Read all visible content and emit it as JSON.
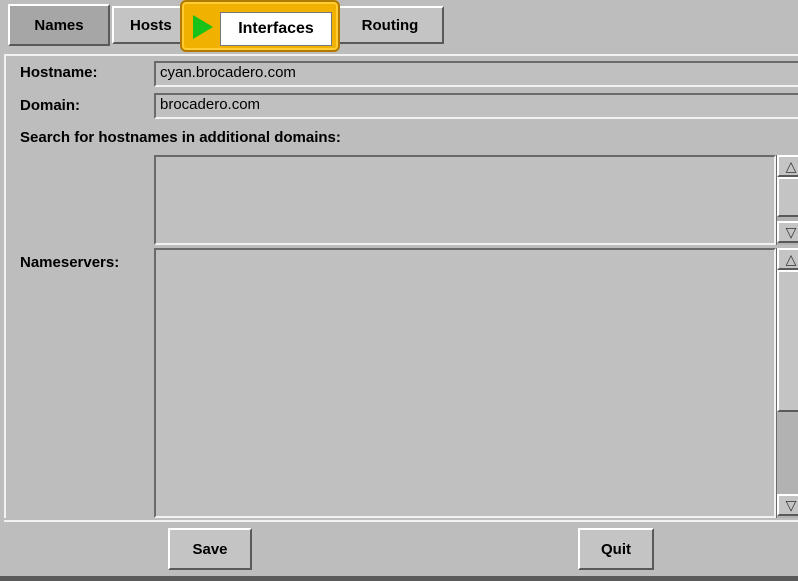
{
  "tabs": {
    "names": "Names",
    "hosts": "Hosts",
    "interfaces": "Interfaces",
    "routing": "Routing",
    "selected": "Names"
  },
  "form": {
    "hostname_label": "Hostname:",
    "hostname_value": "cyan.brocadero.com",
    "domain_label": "Domain:",
    "domain_value": "brocadero.com",
    "search_label": "Search for hostnames in additional domains:",
    "search_domains": [],
    "nameservers_label": "Nameservers:",
    "nameservers": []
  },
  "buttons": {
    "save": "Save",
    "quit": "Quit"
  },
  "icons": {
    "tab_pointer": "play-arrow-icon",
    "scroll_up": "scroll-up-arrow-icon",
    "scroll_down": "scroll-down-arrow-icon"
  },
  "colors": {
    "background": "#bdbdbd",
    "highlight": "#f0b100",
    "pointer_arrow": "#18c218"
  }
}
